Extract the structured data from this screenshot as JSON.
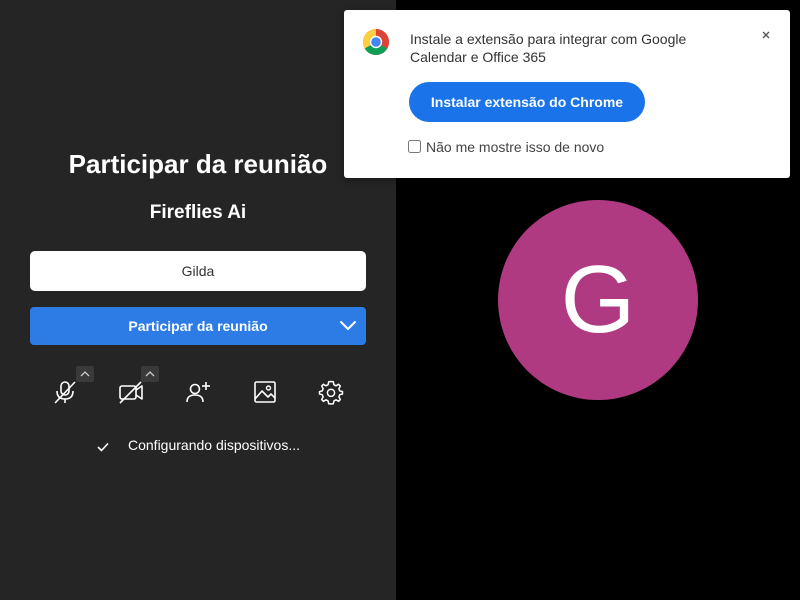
{
  "join": {
    "title": "Participar da reunião",
    "meeting_name": "Fireflies Ai",
    "name_value": "Gilda",
    "join_button_label": "Participar da reunião",
    "status_text": "Configurando dispositivos..."
  },
  "controls": {
    "icons": [
      "microphone-off-icon",
      "camera-off-icon",
      "add-person-icon",
      "image-icon",
      "gear-icon"
    ]
  },
  "avatar": {
    "initial": "G",
    "color": "#b03a82"
  },
  "popup": {
    "message": "Instale a extensão para integrar com Google Calendar e Office 365",
    "install_button_label": "Instalar extensão do Chrome",
    "dont_show_label": "Não me mostre isso de novo",
    "dont_show_checked": false
  },
  "colors": {
    "left_panel_bg": "#252525",
    "video_bg": "#000000",
    "join_button": "#2d7be5",
    "install_button": "#1a73e8"
  }
}
